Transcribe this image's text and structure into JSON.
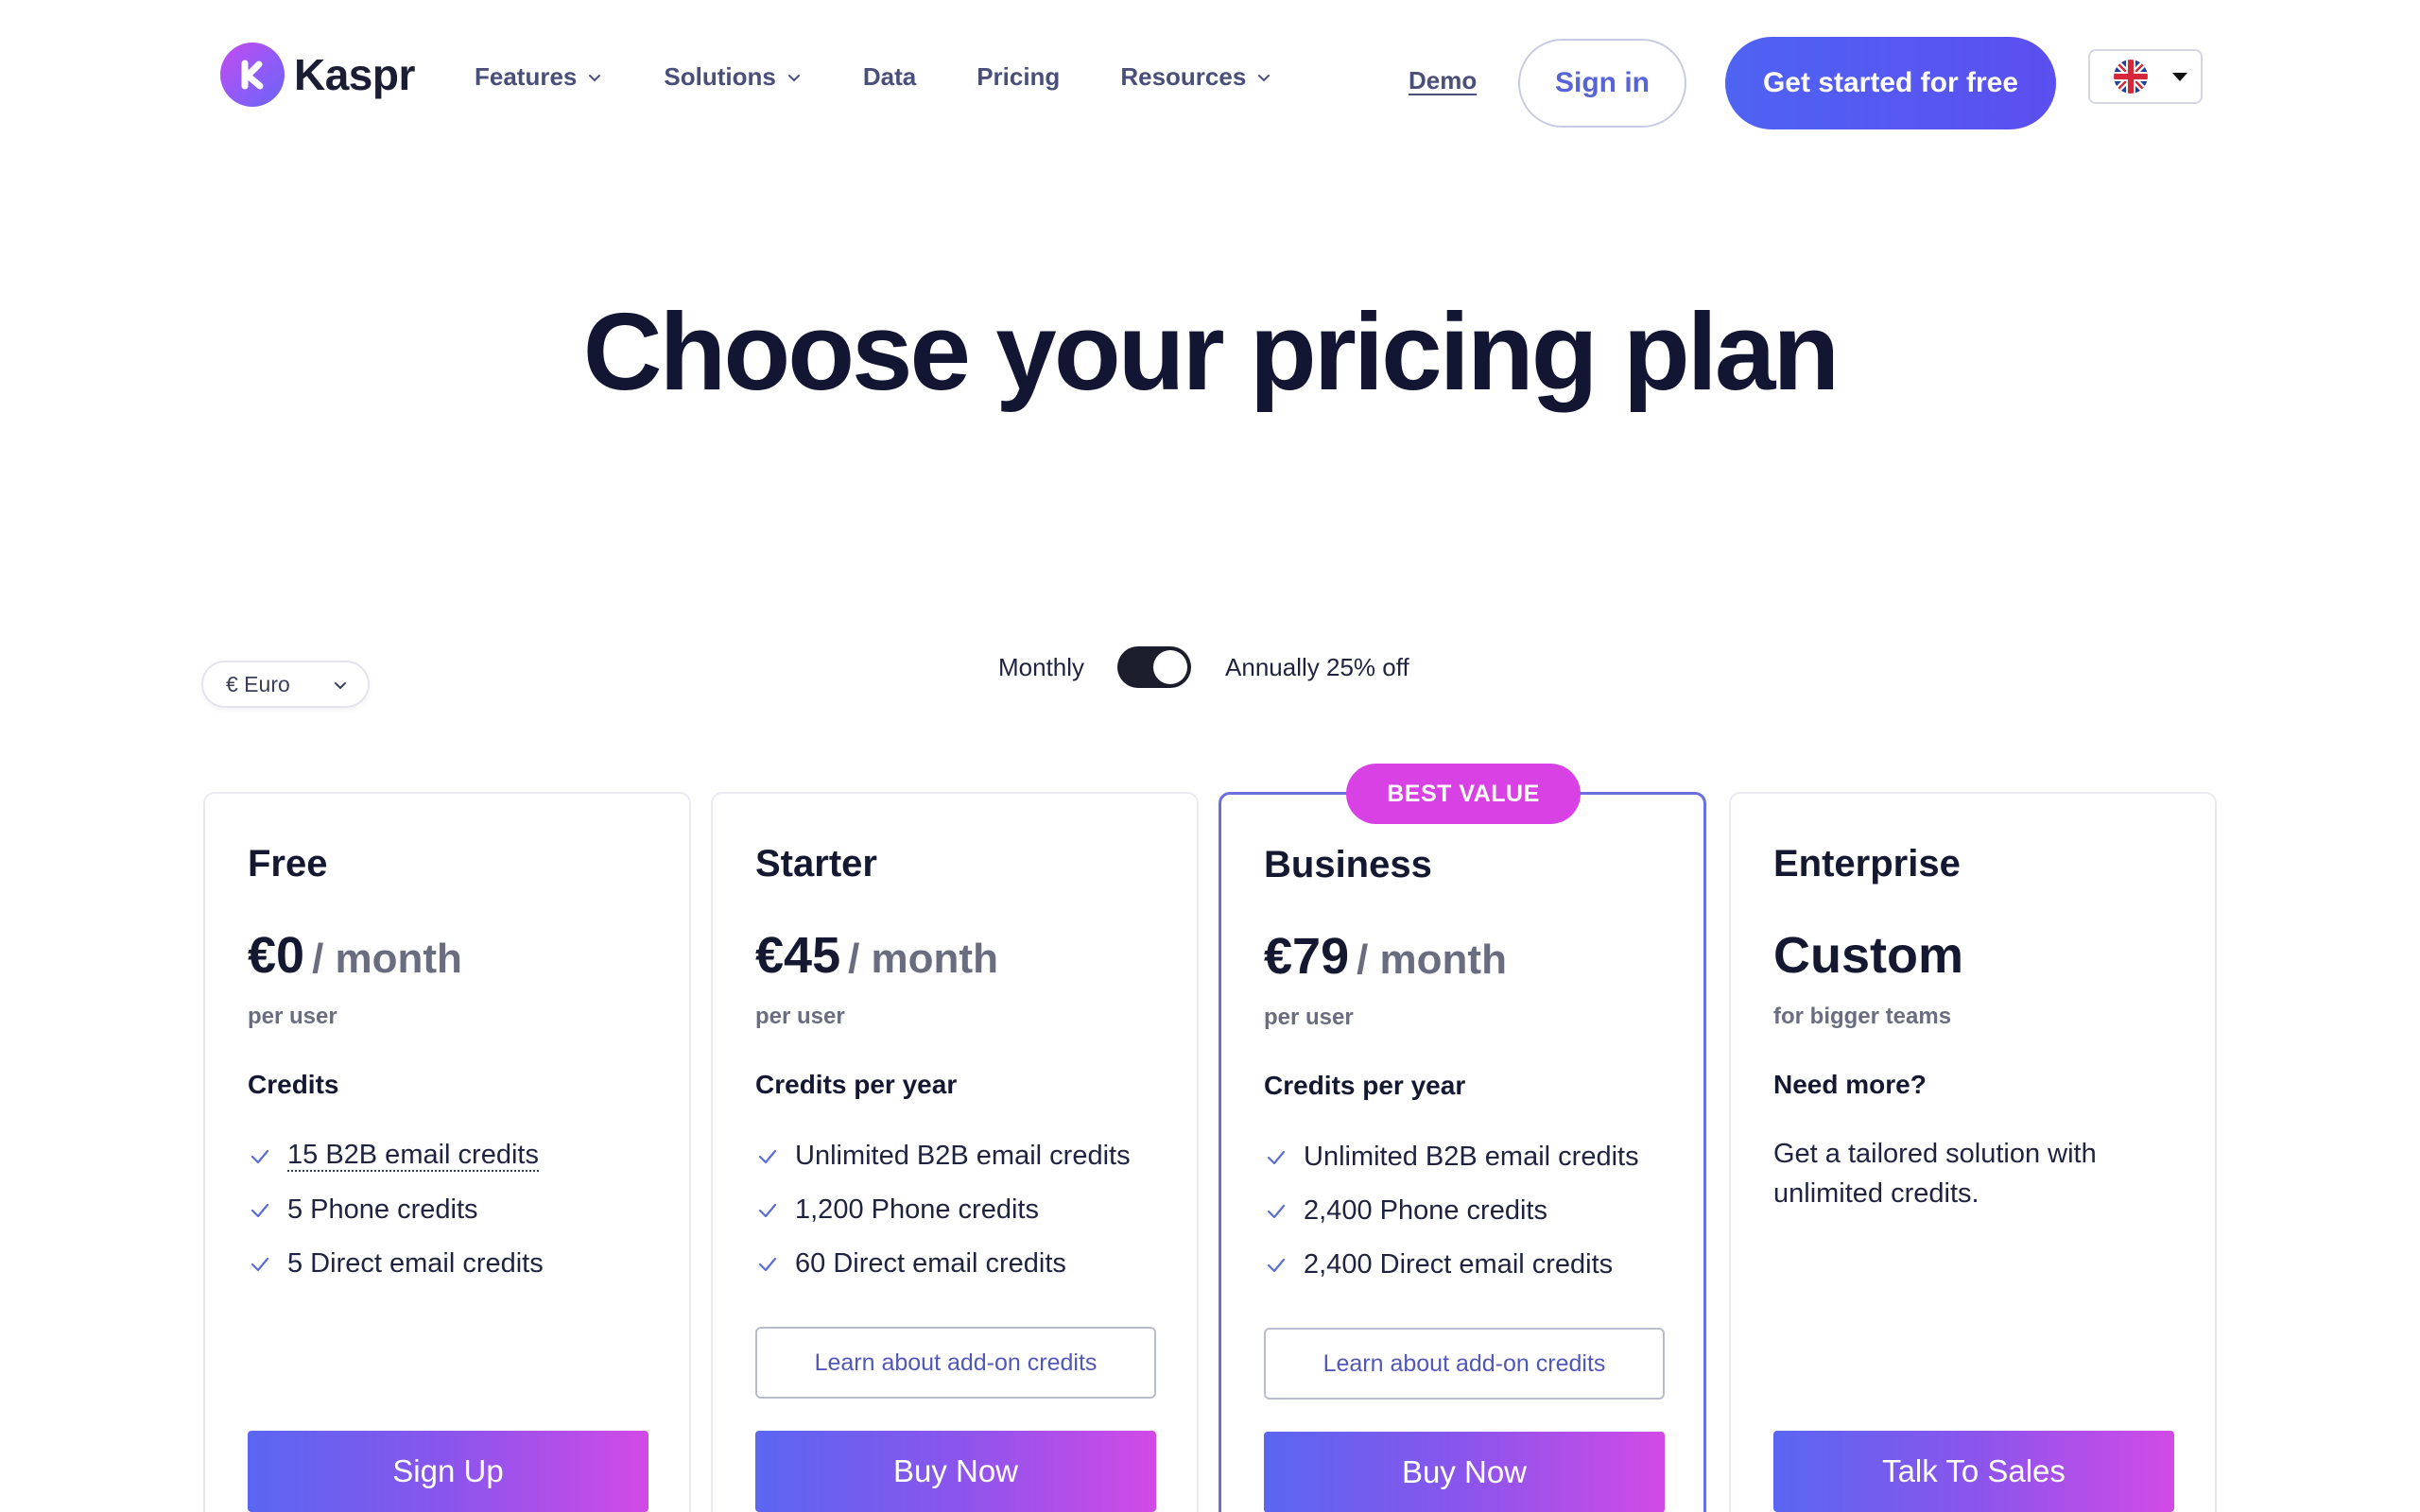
{
  "brand": {
    "name": "Kaspr"
  },
  "nav": {
    "items": [
      {
        "label": "Features",
        "has_dropdown": true
      },
      {
        "label": "Solutions",
        "has_dropdown": true
      },
      {
        "label": "Data",
        "has_dropdown": false
      },
      {
        "label": "Pricing",
        "has_dropdown": false
      },
      {
        "label": "Resources",
        "has_dropdown": true
      }
    ],
    "demo": "Demo",
    "sign_in": "Sign in",
    "get_started": "Get started for free",
    "language_icon": "uk-flag-icon"
  },
  "hero": {
    "title": "Choose your pricing plan"
  },
  "controls": {
    "currency": "€ Euro",
    "billing_monthly": "Monthly",
    "billing_annually": "Annually 25% off",
    "toggle_on": true
  },
  "badge": "BEST VALUE",
  "plans": [
    {
      "name": "Free",
      "price": "€0",
      "period": "/ month",
      "per": "per user",
      "section": "Credits",
      "features": [
        "15 B2B email credits",
        "5 Phone credits",
        "5 Direct email credits"
      ],
      "cta": "Sign Up"
    },
    {
      "name": "Starter",
      "price": "€45",
      "period": "/ month",
      "per": "per user",
      "section": "Credits per year",
      "features": [
        "Unlimited B2B email credits",
        "1,200 Phone credits",
        "60 Direct email credits"
      ],
      "addon": "Learn about add-on credits",
      "cta": "Buy Now"
    },
    {
      "name": "Business",
      "price": "€79",
      "period": "/ month",
      "per": "per user",
      "section": "Credits per year",
      "features": [
        "Unlimited B2B email credits",
        "2,400 Phone credits",
        "2,400 Direct email credits"
      ],
      "addon": "Learn about add-on credits",
      "cta": "Buy Now"
    },
    {
      "name": "Enterprise",
      "price": "Custom",
      "per": "for bigger teams",
      "section": "Need more?",
      "description": "Get a tailored solution with unlimited credits.",
      "cta": "Talk To Sales"
    }
  ],
  "colors": {
    "accent": "#5b4ff0",
    "brand_pink": "#d841e3",
    "featured_border": "#6b6fe0",
    "text_dark": "#141831"
  }
}
